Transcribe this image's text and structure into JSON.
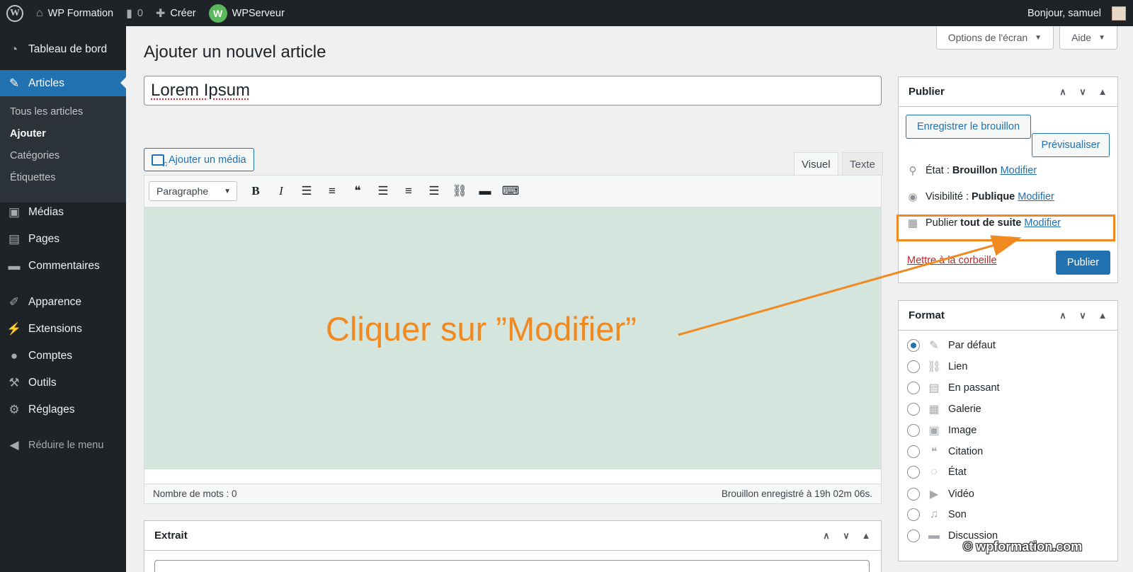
{
  "adminbar": {
    "site_name": "WP Formation",
    "comments_count": "0",
    "create_label": "Créer",
    "plugin_label": "WPServeur",
    "greeting": "Bonjour, samuel"
  },
  "sidebar": {
    "dashboard": "Tableau de bord",
    "articles": "Articles",
    "submenu": [
      "Tous les articles",
      "Ajouter",
      "Catégories",
      "Étiquettes"
    ],
    "medias": "Médias",
    "pages": "Pages",
    "comments": "Commentaires",
    "appearance": "Apparence",
    "extensions": "Extensions",
    "accounts": "Comptes",
    "tools": "Outils",
    "settings": "Réglages",
    "collapse": "Réduire le menu"
  },
  "screen_meta": {
    "options_label": "Options de l'écran",
    "help_label": "Aide"
  },
  "page": {
    "title": "Ajouter un nouvel article",
    "post_title": "Lorem Ipsum"
  },
  "editor": {
    "add_media": "Ajouter un média",
    "tab_visual": "Visuel",
    "tab_text": "Texte",
    "format_select": "Paragraphe",
    "word_count": "Nombre de mots : 0",
    "draft_saved": "Brouillon enregistré à 19h 02m 06s."
  },
  "annotation": {
    "text": "Cliquer sur ”Modifier”",
    "color": "#f0891f"
  },
  "publish": {
    "title": "Publier",
    "save_draft": "Enregistrer le brouillon",
    "preview": "Prévisualiser",
    "status_label": "État :",
    "status_value": "Brouillon",
    "visibility_label": "Visibilité :",
    "visibility_value": "Publique",
    "publish_label": "Publier",
    "publish_value": "tout de suite",
    "edit_link": "Modifier",
    "trash": "Mettre à la corbeille",
    "publish_button": "Publier"
  },
  "format": {
    "title": "Format",
    "options": [
      "Par défaut",
      "Lien",
      "En passant",
      "Galerie",
      "Image",
      "Citation",
      "État",
      "Vidéo",
      "Son",
      "Discussion"
    ],
    "selected": "Par défaut"
  },
  "excerpt": {
    "title": "Extrait"
  },
  "watermark": "© wpformation.com",
  "colors": {
    "admin_dark": "#1d2327",
    "accent_blue": "#2271b1",
    "editor_bg": "#d4e5de",
    "trash_red": "#b32d2e"
  }
}
